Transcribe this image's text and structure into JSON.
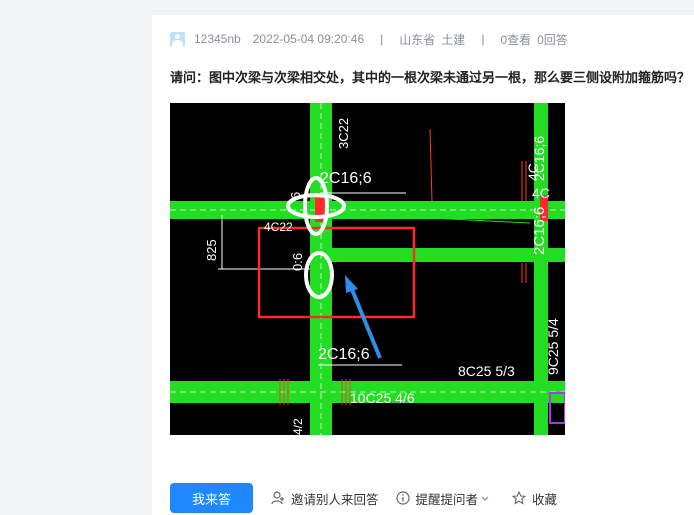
{
  "post": {
    "username": "12345nb",
    "datetime": "2022-05-04 09:20:46",
    "separator": "|",
    "province": "山东省",
    "category": "土建",
    "views": "0查看",
    "answers": "0回答",
    "question": "请问：图中次梁与次梁相交处，其中的一根次梁未通过另一根，那么要三侧设附加箍筋吗？"
  },
  "drawing": {
    "labels": {
      "top_rebar": "2C16;6",
      "bottom_rebar": "2C16;6",
      "side_vertical": "2C16;6",
      "side_vertical_2": "4C",
      "beam_vert_top": "3C22",
      "dim_825": "825",
      "left_small_a": "4C22",
      "left_small_b": "0:6",
      "left_small_c": "6",
      "right_top": "2C16;6",
      "right_mid": "4C",
      "right_low": "9C25 5/4",
      "bottom_left": "4/2",
      "bottom_mid": "10C25 4/6",
      "bottom_right": "8C25 5/3"
    },
    "colors": {
      "beam": "#22dd22",
      "highlight_box": "#ff2a2a",
      "circle": "#ffffff",
      "arrow": "#2f8ce8",
      "accent": "#1f88ff"
    }
  },
  "actions": {
    "answer": "我来答",
    "invite": "邀请别人来回答",
    "remind": "提醒提问者",
    "favorite": "收藏"
  }
}
